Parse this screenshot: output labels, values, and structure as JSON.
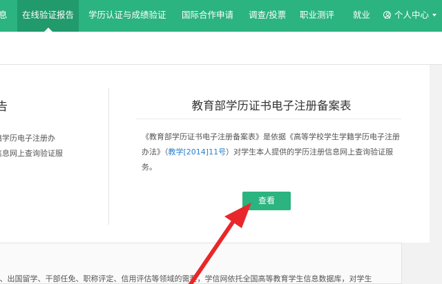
{
  "nav": {
    "items": [
      {
        "label": "息"
      },
      {
        "label": "在线验证报告",
        "active": true
      },
      {
        "label": "学历认证与成绩验证"
      },
      {
        "label": "国际合作申请"
      },
      {
        "label": "调查/投票"
      },
      {
        "label": "职业测评"
      },
      {
        "label": "就业"
      }
    ],
    "user_center": "个人中心",
    "user_icon": "user-icon",
    "chevron_icon": "chevron-down-icon"
  },
  "left_card": {
    "title": "告",
    "lines": [
      "籍学历电子注册办",
      "信息网上查询验证服"
    ]
  },
  "right_card": {
    "title": "教育部学历证书电子注册备案表",
    "desc_part1": "《教育部学历证书电子注册备案表》是依据《高等学校学生学籍学历电子注册办法》（",
    "desc_link": "教学[2014]11号",
    "desc_part2": "）对学生本人提供的学历注册信息网上查询验证服务。",
    "button_label": "查看"
  },
  "bottom": {
    "text": "）、出国留学、干部任免、职称评定、信用评估等领域的需要，学信网依托全国高等教育学生信息数据库，对学生"
  },
  "colors": {
    "brand": "#2bb380",
    "nav_active": "#219a6c",
    "link": "#2a7ec9",
    "arrow": "#e8272a"
  }
}
